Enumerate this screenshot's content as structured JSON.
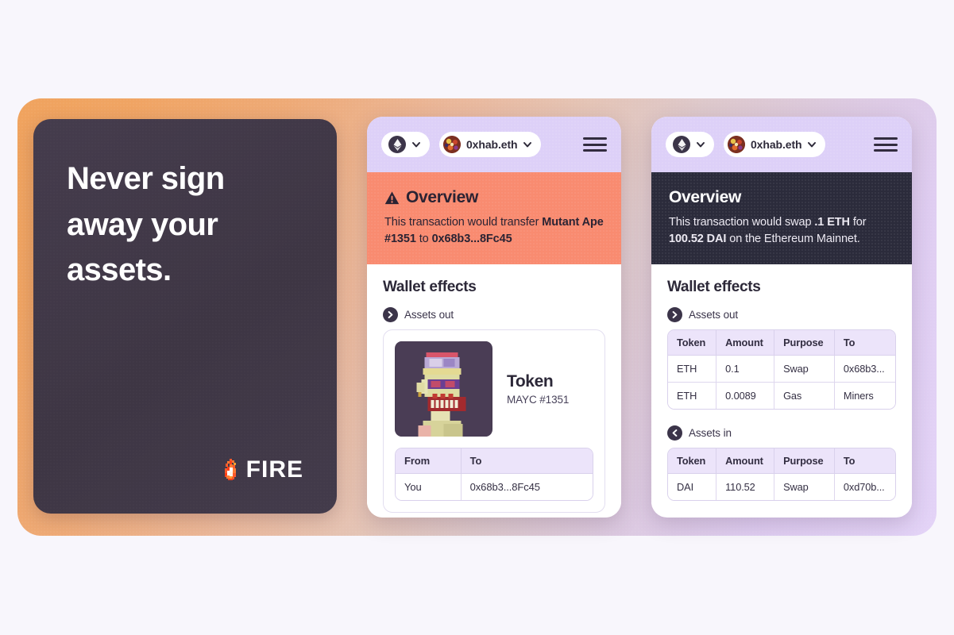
{
  "hero": {
    "headline": "Never sign away your assets.",
    "logo_text": "FIRE",
    "logo_icon": "fire-flame-icon",
    "background_color": "#413949"
  },
  "outer_card": {
    "gradient_from": "#f0a35e",
    "gradient_to": "#e3d3f7"
  },
  "middle_phone": {
    "topbar": {
      "network_icon": "ethereum-icon",
      "network_chevron": "chevron-down-icon",
      "account_avatar": "account-avatar",
      "account_name": "0xhab.eth",
      "account_chevron": "chevron-down-icon",
      "menu_icon": "hamburger-menu-icon",
      "background_color": "#ddd0f8"
    },
    "overview": {
      "icon": "warning-triangle-icon",
      "title": "Overview",
      "text_parts": [
        {
          "text": "This transaction would transfer ",
          "bold": false
        },
        {
          "text": "Mutant Ape #1351",
          "bold": true
        },
        {
          "text": " to ",
          "bold": false
        },
        {
          "text": "0x68b3...8Fc45",
          "bold": true
        }
      ],
      "background_color": "#f98b70"
    },
    "effects": {
      "title": "Wallet effects",
      "group": {
        "icon": "arrow-right-circle-icon",
        "label": "Assets out"
      },
      "nft": {
        "thumbnail": "mutant-ape-nft-thumbnail",
        "name": "Token",
        "subtitle": "MAYC #1351"
      },
      "table": {
        "headers": [
          "From",
          "To"
        ],
        "rows": [
          [
            "You",
            "0x68b3...8Fc45"
          ]
        ]
      }
    }
  },
  "right_phone": {
    "topbar": {
      "network_icon": "ethereum-icon",
      "network_chevron": "chevron-down-icon",
      "account_avatar": "account-avatar",
      "account_name": "0xhab.eth",
      "account_chevron": "chevron-down-icon",
      "menu_icon": "hamburger-menu-icon",
      "background_color": "#ddd0f8"
    },
    "overview": {
      "title": "Overview",
      "text_parts": [
        {
          "text": "This transaction would swap ",
          "bold": false
        },
        {
          "text": ".1 ETH",
          "bold": true
        },
        {
          "text": " for ",
          "bold": false
        },
        {
          "text": "100.52 DAI",
          "bold": true
        },
        {
          "text": " on the Ethereum Mainnet.",
          "bold": false
        }
      ],
      "background_color": "#2b2b3b"
    },
    "effects": {
      "title": "Wallet effects",
      "assets_out": {
        "icon": "arrow-right-circle-icon",
        "label": "Assets out",
        "headers": [
          "Token",
          "Amount",
          "Purpose",
          "To"
        ],
        "rows": [
          [
            "ETH",
            "0.1",
            "Swap",
            "0x68b3..."
          ],
          [
            "ETH",
            "0.0089",
            "Gas",
            "Miners"
          ]
        ]
      },
      "assets_in": {
        "icon": "arrow-left-circle-icon",
        "label": "Assets in",
        "headers": [
          "Token",
          "Amount",
          "Purpose",
          "To"
        ],
        "rows": [
          [
            "DAI",
            "110.52",
            "Swap",
            "0xd70b..."
          ]
        ]
      }
    }
  }
}
